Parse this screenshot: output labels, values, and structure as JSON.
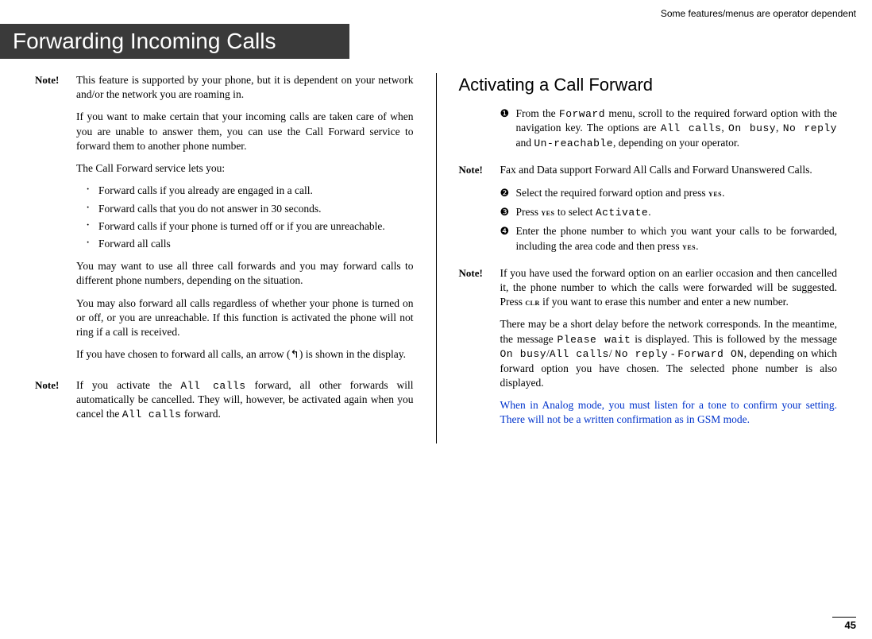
{
  "header": {
    "topnote": "Some features/menus are operator dependent",
    "title": "Forwarding Incoming Calls"
  },
  "left": {
    "note1_label": "Note!",
    "note1_p1": "This feature is supported by your phone, but it is dependent on your network and/or the network you are roaming in.",
    "note1_p2": "If you want to make certain that your incoming calls are taken care of when you are unable to answer them, you can use the Call Forward service to forward them to another phone number.",
    "note1_p3": "The Call Forward service lets you:",
    "bullets": [
      "Forward calls if you already are engaged in a call.",
      "Forward calls that you do not answer in 30 seconds.",
      "Forward calls if your phone is turned off or if you are unreachable.",
      "Forward all calls"
    ],
    "note1_p4": "You may want to use all three call forwards and you may forward calls to different phone numbers, depending on the situation.",
    "note1_p5": "You may also forward all calls regardless of whether your phone is turned on or off, or you are unreachable. If this function is activated the phone will not ring if a call is received.",
    "note1_p6a": "If you have chosen to forward all calls, an arrow (",
    "note1_p6b": ") is shown in the display.",
    "note2_label": "Note!",
    "note2_a": "If you activate the ",
    "note2_code1": "All calls",
    "note2_b": " forward, all other forwards will automatically be cancelled. They will, however, be activated again when you cancel the ",
    "note2_code2": "All calls",
    "note2_c": " forward."
  },
  "right": {
    "section_title": "Activating a Call Forward",
    "step1_a": "From the ",
    "step1_code1": "Forward",
    "step1_b": " menu, scroll to the required forward option with the navigation key. The options are ",
    "step1_code2": "All calls",
    "step1_c": ", ",
    "step1_code3": "On busy",
    "step1_d": ", ",
    "step1_code4": "No reply",
    "step1_e": " and ",
    "step1_code5": "Un-reachable",
    "step1_f": ", depending on your operator.",
    "rnote1_label": "Note!",
    "rnote1": "Fax and Data support Forward All Calls and Forward Unanswered Calls.",
    "step2_a": "Select the required forward option and press ",
    "step2_yes": "yes",
    "step2_b": ".",
    "step3_a": "Press ",
    "step3_yes": "yes",
    "step3_b": " to select ",
    "step3_code": "Activate",
    "step3_c": ".",
    "step4_a": "Enter the phone number to which you want your calls to be forwarded, including the area code and then press ",
    "step4_yes": "yes",
    "step4_b": ".",
    "rnote2_label": "Note!",
    "rnote2_a": "If you have used the forward option on an earlier occasion and then cancelled it, the phone number to which the calls were forwarded will be suggested. Press ",
    "rnote2_clr": "clr",
    "rnote2_b": " if you want to erase this number and enter a new number.",
    "rnote2_p2a": "There may be a short delay before the network corresponds. In the meantime, the message ",
    "rnote2_code1": "Please wait",
    "rnote2_p2b": " is displayed. This is followed by the message ",
    "rnote2_code2": "On busy",
    "rnote2_slash1": "/",
    "rnote2_code3": "All calls",
    "rnote2_slash2": "/ ",
    "rnote2_code4": "No reply",
    "rnote2_dash": " - ",
    "rnote2_code5": "Forward ON",
    "rnote2_p2c": ", depending on which forward option you have chosen. The selected phone number is also displayed.",
    "blue_p": "When in Analog mode, you must listen for a tone to confirm your  setting. There will not be a written confirmation as in GSM mode."
  },
  "pagenum": "45"
}
